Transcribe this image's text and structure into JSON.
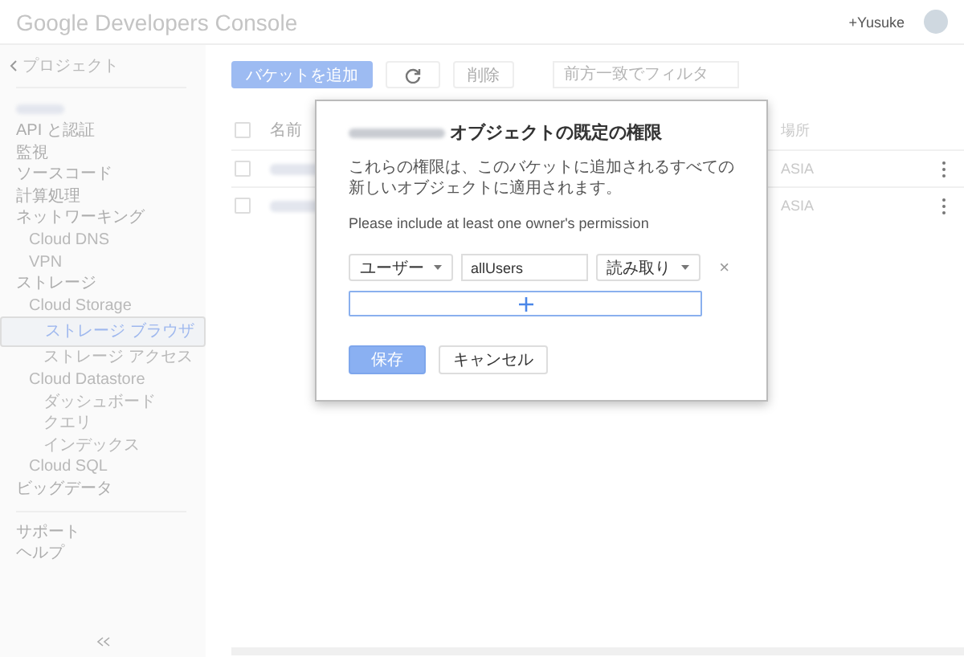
{
  "header": {
    "logo": "Google Developers Console",
    "user": "+Yusuke"
  },
  "sidebar": {
    "back": "プロジェクト",
    "sections": [
      {
        "items": [
          {
            "label": "API と認証",
            "selected": false
          },
          {
            "label": "監視",
            "selected": false
          },
          {
            "label": "ソースコード",
            "selected": false
          },
          {
            "label": "計算処理",
            "selected": false
          },
          {
            "label": "ネットワーキング",
            "selected": false,
            "children": [
              {
                "label": "Cloud DNS",
                "selected": false
              },
              {
                "label": "VPN",
                "selected": false
              }
            ]
          },
          {
            "label": "ストレージ",
            "selected": false,
            "children": [
              {
                "label": "Cloud Storage",
                "selected": false,
                "children": [
                  {
                    "label": "ストレージ ブラウザ",
                    "selected": true
                  },
                  {
                    "label": "ストレージ アクセス",
                    "selected": false
                  }
                ]
              },
              {
                "label": "Cloud Datastore",
                "selected": false,
                "children": [
                  {
                    "label": "ダッシュボード",
                    "selected": false
                  },
                  {
                    "label": "クエリ",
                    "selected": false
                  },
                  {
                    "label": "インデックス",
                    "selected": false
                  }
                ]
              },
              {
                "label": "Cloud SQL",
                "selected": false
              }
            ]
          },
          {
            "label": "ビッグデータ",
            "selected": false
          }
        ]
      },
      {
        "items": [
          {
            "label": "サポート",
            "selected": false
          },
          {
            "label": "ヘルプ",
            "selected": false
          }
        ]
      }
    ]
  },
  "toolbar": {
    "add_button": "バケットを追加",
    "delete_button": "削除",
    "filter": {
      "placeholder": "前方一致でフィルタ"
    }
  },
  "table": {
    "columns": [
      "名前",
      "場所"
    ],
    "all_checked": false,
    "rows": [
      {
        "checked": false,
        "location": "ASIA"
      },
      {
        "checked": false,
        "location": "ASIA"
      }
    ]
  },
  "dialog": {
    "title": "オブジェクトの既定の権限",
    "description": "これらの権限は、このバケットに追加されるすべての新しいオブジェクトに適用されます。",
    "note": "Please include at least one owner's permission",
    "permissions": [
      {
        "entity": "ユーザー",
        "value": "allUsers",
        "role": "読み取り",
        "remove": "×"
      }
    ],
    "buttons": [
      {
        "label": "保存",
        "kind": "primary"
      },
      {
        "label": "キャンセル",
        "kind": "secondary"
      }
    ]
  }
}
